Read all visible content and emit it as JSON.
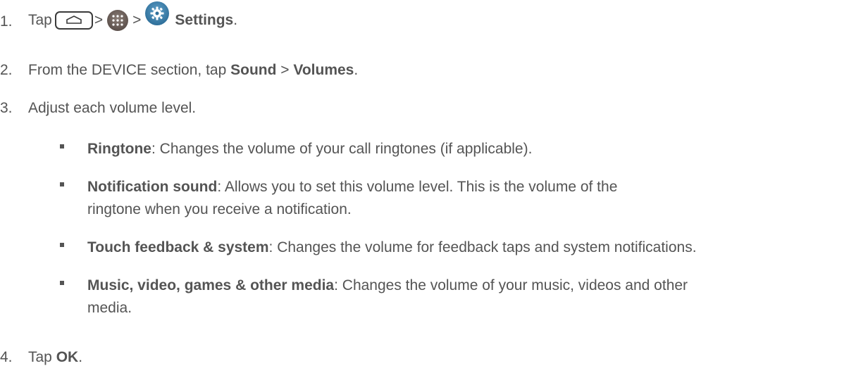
{
  "steps": [
    {
      "num": "1.",
      "tap": "Tap",
      "sep1": ">",
      "sep2": ">",
      "settings": "Settings",
      "end": "."
    },
    {
      "num": "2.",
      "pre": "From the DEVICE section, tap ",
      "b1": "Sound",
      "mid": " > ",
      "b2": "Volumes",
      "end": "."
    },
    {
      "num": "3.",
      "text": "Adjust each volume level."
    },
    {
      "num": "4.",
      "pre": "Tap ",
      "b1": "OK",
      "end": "."
    }
  ],
  "bullets": [
    {
      "term": "Ringtone",
      "desc": ": Changes the volume of your call ringtones (if applicable)."
    },
    {
      "term": "Notification sound",
      "desc": ": Allows you to set this volume level. This is the volume of the ringtone when you receive a notification."
    },
    {
      "term": "Touch feedback & system",
      "desc": ": Changes the volume for feedback taps and system notifications."
    },
    {
      "term": "Music, video, games & other media",
      "desc": ": Changes the volume of your music, videos and other media."
    }
  ],
  "icons": [
    "home-icon",
    "apps-icon",
    "settings-icon"
  ]
}
